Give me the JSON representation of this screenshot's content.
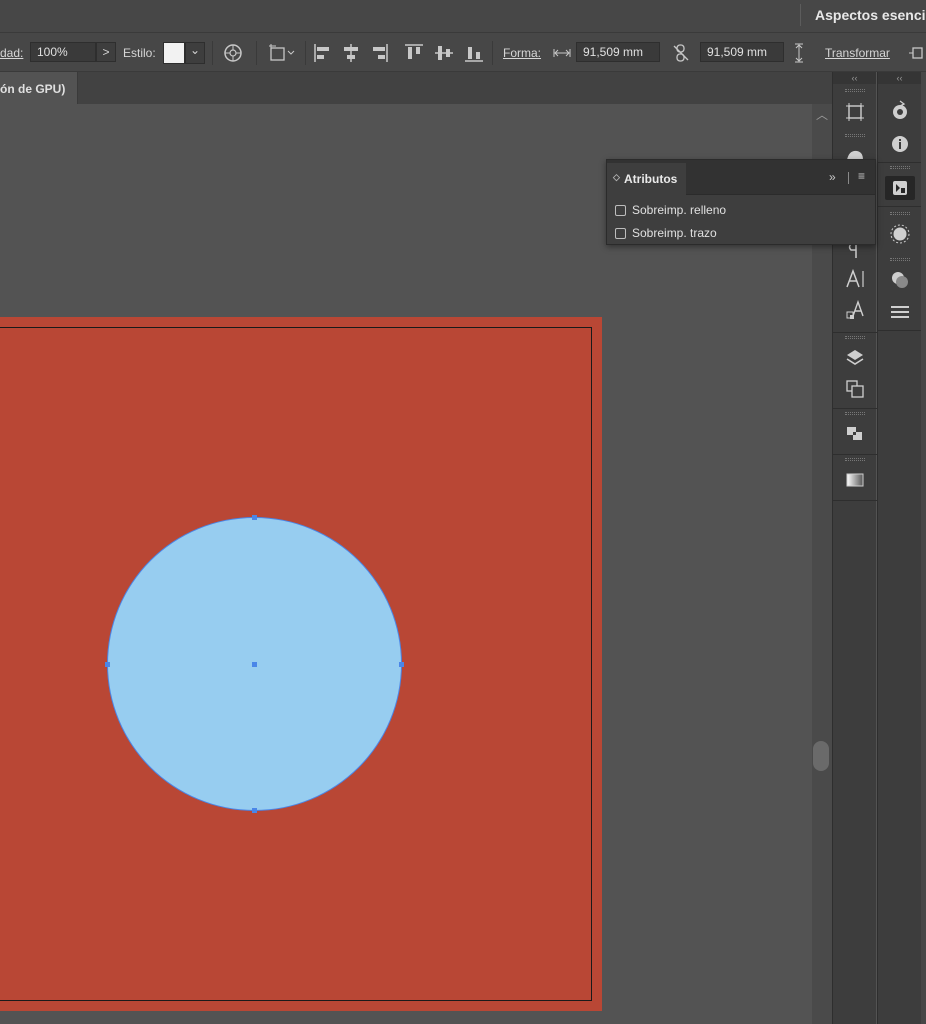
{
  "topbar": {
    "workspace_label": "Aspectos esenci"
  },
  "controlbar": {
    "opacity_label": "dad:",
    "opacity_value": "100%",
    "opacity_arrow": ">",
    "style_label": "Estilo:",
    "style_dropdown_arrow": "⌄",
    "shape_label": "Forma:",
    "width_value": "91,509 mm",
    "height_value": "91,509 mm",
    "transform_label": "Transformar"
  },
  "tabs": [
    {
      "label": "ón de GPU)"
    }
  ],
  "panel": {
    "title": "Atributos",
    "tab_arrows": "◇",
    "collapse_glyph": "»",
    "menu_glyph": "≡",
    "options": [
      {
        "label": "Sobreimp. relleno",
        "checked": false
      },
      {
        "label": "Sobreimp. trazo",
        "checked": false
      }
    ]
  },
  "dock": {
    "collapse_glyph": "‹‹"
  },
  "colors": {
    "artboard": "#b94735",
    "circle_fill": "#97cdf0",
    "selection": "#4a86e8",
    "canvas": "#535353"
  }
}
